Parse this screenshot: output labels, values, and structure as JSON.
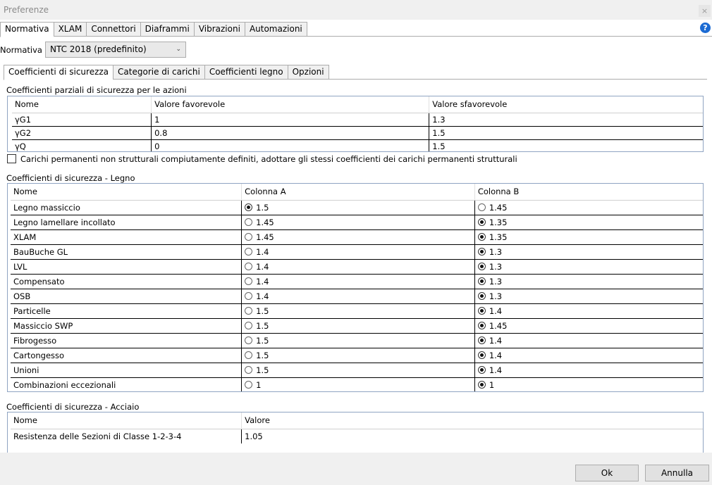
{
  "window": {
    "title": "Preferenze",
    "close_glyph": "×"
  },
  "main_tabs": [
    {
      "label": "Normativa",
      "active": true
    },
    {
      "label": "XLAM",
      "active": false
    },
    {
      "label": "Connettori",
      "active": false
    },
    {
      "label": "Diaframmi",
      "active": false
    },
    {
      "label": "Vibrazioni",
      "active": false
    },
    {
      "label": "Automazioni",
      "active": false
    }
  ],
  "help_glyph": "?",
  "normativa": {
    "label": "Normativa",
    "selected": "NTC 2018 (predefinito)"
  },
  "sub_tabs": [
    {
      "label": "Coefficienti di sicurezza",
      "active": true
    },
    {
      "label": "Categorie di carichi",
      "active": false
    },
    {
      "label": "Coefficienti legno",
      "active": false
    },
    {
      "label": "Opzioni",
      "active": false
    }
  ],
  "azioni": {
    "title": "Coefficienti parziali di sicurezza per le azioni",
    "headers": [
      "Nome",
      "Valore favorevole",
      "Valore sfavorevole"
    ],
    "rows": [
      [
        "γG1",
        "1",
        "1.3"
      ],
      [
        "γG2",
        "0.8",
        "1.5"
      ],
      [
        "γQ",
        "0",
        "1.5"
      ]
    ]
  },
  "checkbox_label": "Carichi permanenti non strutturali compiutamente definiti, adottare gli stessi coefficienti dei carichi permanenti strutturali",
  "legno": {
    "title": "Coefficienti di sicurezza - Legno",
    "headers": [
      "Nome",
      "Colonna A",
      "Colonna B"
    ],
    "rows": [
      {
        "name": "Legno massiccio",
        "a": "1.5",
        "b": "1.45",
        "selected": "A"
      },
      {
        "name": "Legno lamellare incollato",
        "a": "1.45",
        "b": "1.35",
        "selected": "B"
      },
      {
        "name": "XLAM",
        "a": "1.45",
        "b": "1.35",
        "selected": "B"
      },
      {
        "name": "BauBuche GL",
        "a": "1.4",
        "b": "1.3",
        "selected": "B"
      },
      {
        "name": "LVL",
        "a": "1.4",
        "b": "1.3",
        "selected": "B"
      },
      {
        "name": "Compensato",
        "a": "1.4",
        "b": "1.3",
        "selected": "B"
      },
      {
        "name": "OSB",
        "a": "1.4",
        "b": "1.3",
        "selected": "B"
      },
      {
        "name": "Particelle",
        "a": "1.5",
        "b": "1.4",
        "selected": "B"
      },
      {
        "name": "Massiccio SWP",
        "a": "1.5",
        "b": "1.45",
        "selected": "B"
      },
      {
        "name": "Fibrogesso",
        "a": "1.5",
        "b": "1.4",
        "selected": "B"
      },
      {
        "name": "Cartongesso",
        "a": "1.5",
        "b": "1.4",
        "selected": "B"
      },
      {
        "name": "Unioni",
        "a": "1.5",
        "b": "1.4",
        "selected": "B"
      },
      {
        "name": "Combinazioni eccezionali",
        "a": "1",
        "b": "1",
        "selected": "B"
      }
    ]
  },
  "acciaio": {
    "title": "Coefficienti di sicurezza - Acciaio",
    "headers": [
      "Nome",
      "Valore"
    ],
    "rows": [
      [
        "Resistenza delle Sezioni di Classe 1-2-3-4",
        "1.05"
      ]
    ]
  },
  "buttons": {
    "ok": "Ok",
    "cancel": "Annulla"
  }
}
